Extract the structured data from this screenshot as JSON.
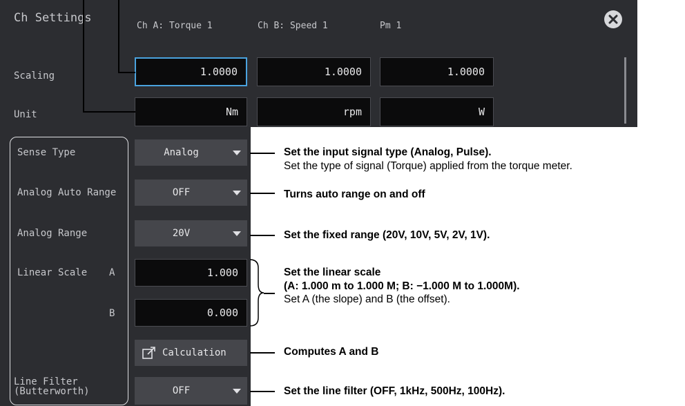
{
  "dialog": {
    "title": "Ch Settings",
    "columns": [
      "Ch A: Torque 1",
      "Ch B: Speed 1",
      "Pm 1"
    ]
  },
  "scaling": {
    "label": "Scaling",
    "values": [
      "1.0000",
      "1.0000",
      "1.0000"
    ]
  },
  "unit": {
    "label": "Unit",
    "values": [
      "Nm",
      "rpm",
      "W"
    ]
  },
  "sense_type": {
    "label": "Sense Type",
    "value": "Analog"
  },
  "analog_auto_range": {
    "label": "Analog Auto Range",
    "value": "OFF"
  },
  "analog_range": {
    "label": "Analog Range",
    "value": "20V"
  },
  "linear_scale": {
    "label": "Linear Scale",
    "a_label": "A",
    "b_label": "B",
    "a_value": "1.000",
    "b_value": "0.000"
  },
  "calculation": {
    "label": "Calculation"
  },
  "line_filter": {
    "label_line1": "Line Filter",
    "label_line2": "(Butterworth)",
    "value": "OFF"
  },
  "annotations": {
    "sense_type_title": "Set the input signal type (Analog, Pulse).",
    "sense_type_desc": "Set the type of signal (Torque) applied from the torque meter.",
    "auto_range": "Turns auto range on and off",
    "fixed_range": "Set the fixed range (20V, 10V, 5V, 2V, 1V).",
    "linear_title": "Set the linear scale",
    "linear_range": "(A: 1.000 m to 1.000 M; B: −1.000 M to 1.000M).",
    "linear_desc": "Set A (the slope) and B (the offset).",
    "calculation": "Computes A and B",
    "line_filter": "Set the line filter (OFF, 1kHz, 500Hz, 100Hz)."
  },
  "colors": {
    "panel": "#2c2d31",
    "field": "#0b0b0c",
    "dropdown": "#45464b",
    "selection": "#4aa3df"
  },
  "icons": [
    "close-icon",
    "popup-window-icon",
    "dropdown-arrow-icon"
  ]
}
